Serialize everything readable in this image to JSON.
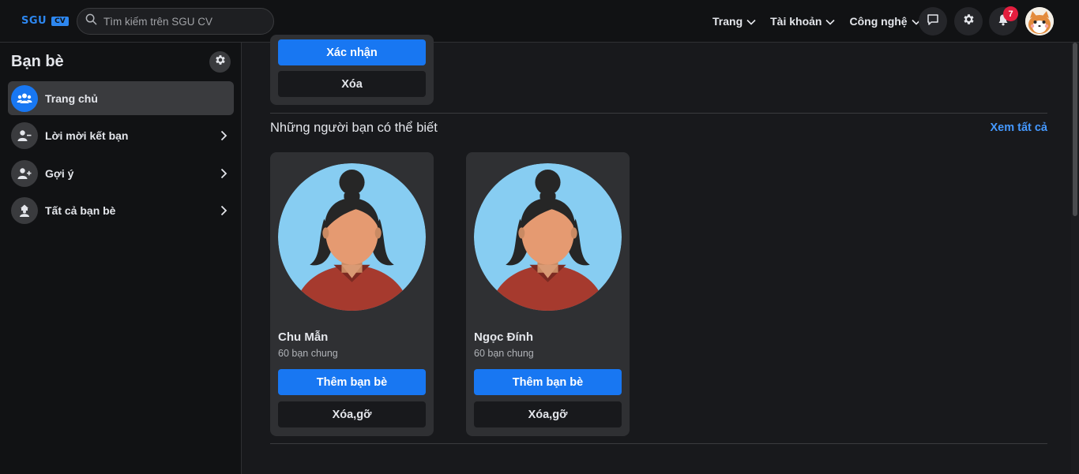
{
  "header": {
    "logo_text": "SGU",
    "logo_badge": "CV",
    "search_placeholder": "Tìm kiếm trên SGU CV",
    "menus": [
      {
        "label": "Trang"
      },
      {
        "label": "Tài khoản"
      },
      {
        "label": "Công nghệ"
      }
    ],
    "notification_count": "7"
  },
  "sidebar": {
    "title": "Bạn bè",
    "items": [
      {
        "label": "Trang chủ",
        "icon": "friends-icon",
        "active": true
      },
      {
        "label": "Lời mời kết bạn",
        "icon": "user-minus-icon"
      },
      {
        "label": "Gợi ý",
        "icon": "user-plus-icon"
      },
      {
        "label": "Tất cả bạn bè",
        "icon": "all-friends-icon"
      }
    ]
  },
  "requests": {
    "confirm_label": "Xác nhận",
    "delete_label": "Xóa"
  },
  "suggestions": {
    "title": "Những người bạn có thể biết",
    "see_all": "Xem tất cả",
    "people": [
      {
        "name": "Chu Mẫn",
        "mutual": "60 bạn chung",
        "add_label": "Thêm bạn bè",
        "remove_label": "Xóa,gỡ"
      },
      {
        "name": "Ngọc Đính",
        "mutual": "60 bạn chung",
        "add_label": "Thêm bạn bè",
        "remove_label": "Xóa,gỡ"
      }
    ]
  },
  "colors": {
    "accent": "#1877f2",
    "link": "#4599ff",
    "badge": "#e41e3f",
    "card_bg": "#2f3033",
    "page_bg": "#18191c"
  }
}
